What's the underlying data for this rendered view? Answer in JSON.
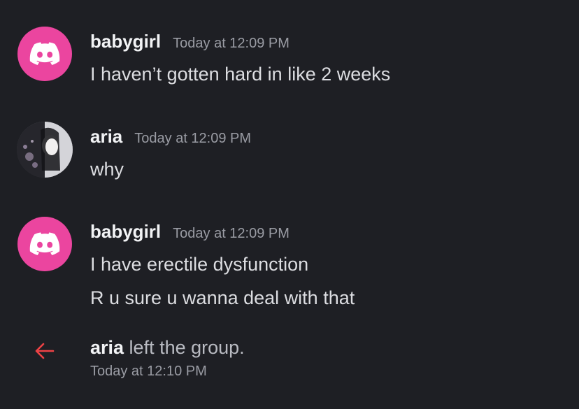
{
  "messages": [
    {
      "author": "babygirl",
      "avatar": "discord-logo-icon",
      "time": "Today at 12:09 PM",
      "lines": [
        "I haven’t gotten hard in like 2 weeks"
      ]
    },
    {
      "author": "aria",
      "avatar": "profile-photo",
      "time": "Today at 12:09 PM",
      "lines": [
        "why"
      ]
    },
    {
      "author": "babygirl",
      "avatar": "discord-logo-icon",
      "time": "Today at 12:09 PM",
      "lines": [
        "I have erectile dysfunction",
        "R u sure u wanna deal with that"
      ]
    }
  ],
  "system_event": {
    "icon": "arrow-left-icon",
    "user": "aria",
    "text": " left the group.",
    "time": "Today at 12:10 PM"
  },
  "colors": {
    "background": "#1e1f24",
    "discord_avatar": "#eb459f",
    "leave_arrow": "#ed4245"
  }
}
